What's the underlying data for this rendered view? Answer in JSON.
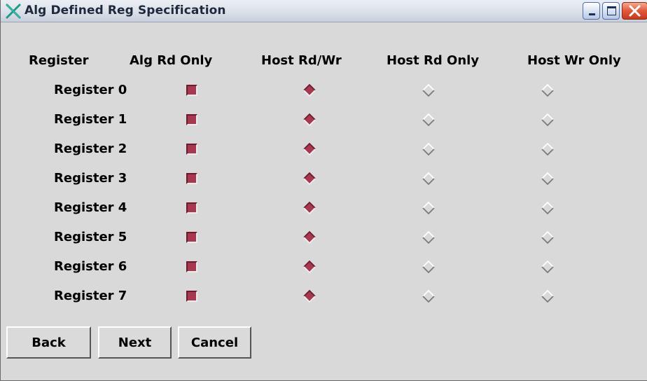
{
  "window": {
    "title": "Alg Defined Reg Specification"
  },
  "icons": {
    "app": "x-logo-icon",
    "minimize": "minimize-icon",
    "maximize": "maximize-icon",
    "close": "close-icon"
  },
  "colors": {
    "accent": "#a6384f"
  },
  "columns": [
    "Register",
    "Alg Rd Only",
    "Host Rd/Wr",
    "Host Rd Only",
    "Host Wr Only"
  ],
  "registers": [
    {
      "label": "Register 0",
      "alg_rd_only": true,
      "access": "Host Rd/Wr"
    },
    {
      "label": "Register 1",
      "alg_rd_only": true,
      "access": "Host Rd/Wr"
    },
    {
      "label": "Register 2",
      "alg_rd_only": true,
      "access": "Host Rd/Wr"
    },
    {
      "label": "Register 3",
      "alg_rd_only": true,
      "access": "Host Rd/Wr"
    },
    {
      "label": "Register 4",
      "alg_rd_only": true,
      "access": "Host Rd/Wr"
    },
    {
      "label": "Register 5",
      "alg_rd_only": true,
      "access": "Host Rd/Wr"
    },
    {
      "label": "Register 6",
      "alg_rd_only": true,
      "access": "Host Rd/Wr"
    },
    {
      "label": "Register 7",
      "alg_rd_only": true,
      "access": "Host Rd/Wr"
    }
  ],
  "buttons": {
    "back": "Back",
    "next": "Next",
    "cancel": "Cancel"
  }
}
